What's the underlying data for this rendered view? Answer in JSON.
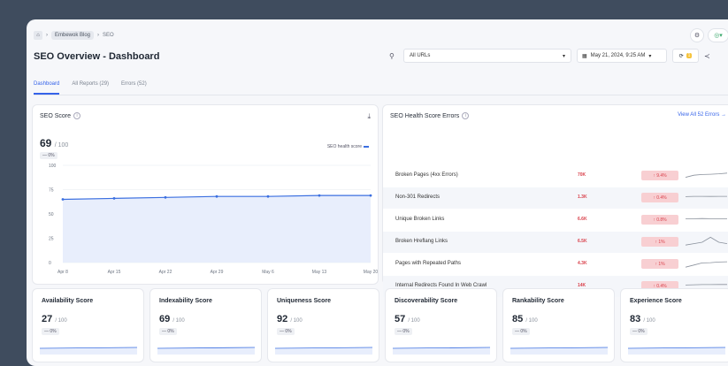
{
  "breadcrumb": {
    "site": "Embewok Blog",
    "section": "SEO"
  },
  "header": {
    "title": "SEO Overview - Dashboard"
  },
  "controls": {
    "url_filter": "All URLs",
    "date": "May 21, 2024, 9:25 AM",
    "refresh_badge": "1"
  },
  "tabs": [
    {
      "label": "Dashboard"
    },
    {
      "label": "All Reports (29)"
    },
    {
      "label": "Errors (52)"
    }
  ],
  "score_panel": {
    "title": "SEO Score",
    "score": "69",
    "denominator": "/ 100",
    "delta": "— 0%",
    "legend": "SEO health score"
  },
  "chart_data": {
    "type": "line",
    "x": [
      "Apr 8",
      "Apr 15",
      "Apr 22",
      "Apr 29",
      "May 6",
      "May 13",
      "May 20"
    ],
    "series": [
      {
        "values": [
          65,
          66,
          67,
          68,
          68,
          69,
          69
        ]
      }
    ],
    "ylim": [
      0,
      100
    ],
    "yticks": [
      0,
      25,
      50,
      75,
      100
    ]
  },
  "errors_panel": {
    "title": "SEO Health Score Errors",
    "view_all": "View All 52 Errors",
    "rows": [
      {
        "label": "Broken Pages (4xx Errors)",
        "count": "70K",
        "change": "↑ 9.4%",
        "spark": [
          0.4,
          0.55,
          0.6,
          0.62,
          0.65,
          0.7
        ]
      },
      {
        "label": "Non-301 Redirects",
        "count": "1.3K",
        "change": "↑ 0.4%",
        "spark": [
          0.6,
          0.62,
          0.62,
          0.61,
          0.62,
          0.62
        ]
      },
      {
        "label": "Unique Broken Links",
        "count": "6.6K",
        "change": "↑ 0.8%",
        "spark": [
          0.6,
          0.6,
          0.61,
          0.6,
          0.6,
          0.6
        ]
      },
      {
        "label": "Broken Hreflang Links",
        "count": "6.5K",
        "change": "↑ 1%",
        "spark": [
          0.3,
          0.4,
          0.5,
          0.85,
          0.5,
          0.4
        ]
      },
      {
        "label": "Pages with Repeated Paths",
        "count": "4.3K",
        "change": "↑ 1%",
        "spark": [
          0.3,
          0.45,
          0.6,
          0.62,
          0.66,
          0.68
        ]
      },
      {
        "label": "Internal Redirects Found In Web Crawl",
        "count": "14K",
        "change": "↑ 0.4%",
        "spark": [
          0.6,
          0.62,
          0.63,
          0.63,
          0.64,
          0.64
        ]
      }
    ]
  },
  "cards": [
    {
      "title": "Availability Score",
      "score": "27",
      "den": "/ 100",
      "delta": "— 0%"
    },
    {
      "title": "Indexability Score",
      "score": "69",
      "den": "/ 100",
      "delta": "— 0%"
    },
    {
      "title": "Uniqueness Score",
      "score": "92",
      "den": "/ 100",
      "delta": "— 0%"
    },
    {
      "title": "Discoverability Score",
      "score": "57",
      "den": "/ 100",
      "delta": "— 0%"
    },
    {
      "title": "Rankability Score",
      "score": "85",
      "den": "/ 100",
      "delta": "— 0%"
    },
    {
      "title": "Experience Score",
      "score": "83",
      "den": "/ 100",
      "delta": "— 0%"
    }
  ],
  "colors": {
    "accent": "#3563e9",
    "error": "#d9414b",
    "line": "#3b6fe0"
  }
}
